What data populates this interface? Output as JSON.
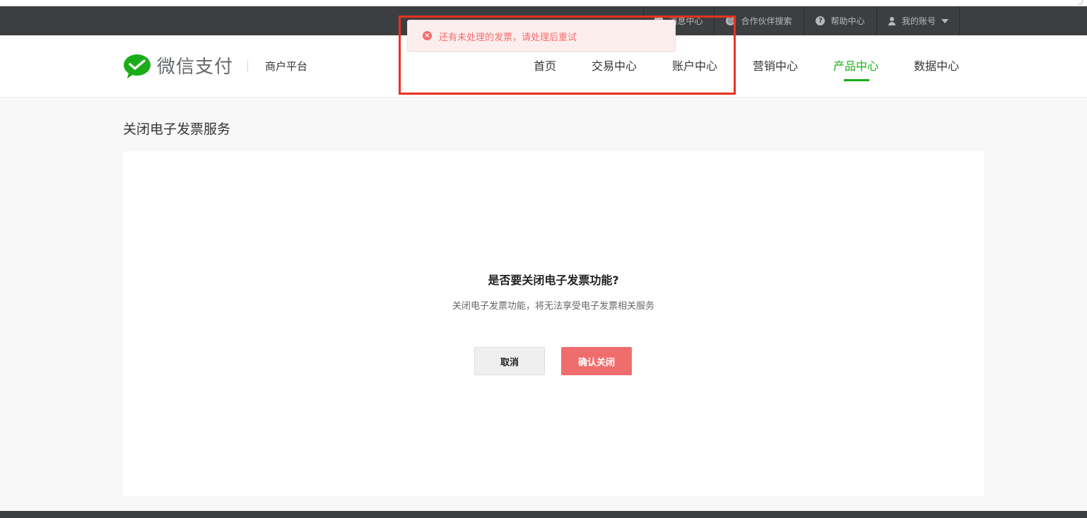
{
  "utilbar": {
    "items": [
      {
        "label": "消息中心",
        "icon": "message-icon"
      },
      {
        "label": "合作伙伴搜索",
        "icon": "partner-search-icon"
      },
      {
        "label": "帮助中心",
        "icon": "help-icon"
      },
      {
        "label": "我的账号",
        "icon": "user-icon"
      }
    ],
    "bg_color": "#3d3e41"
  },
  "header": {
    "brand": "微信支付",
    "subtitle": "商户平台",
    "nav": [
      "首页",
      "交易中心",
      "账户中心",
      "营销中心",
      "产品中心",
      "数据中心"
    ],
    "active_nav": "产品中心",
    "accent_color": "#1aad19"
  },
  "page": {
    "title": "关闭电子发票服务"
  },
  "dialog": {
    "title": "是否要关闭电子发票功能?",
    "description": "关闭电子发票功能，将无法享受电子发票相关服务",
    "cancel_label": "取消",
    "confirm_label": "确认关闭",
    "confirm_color": "#f06d6d"
  },
  "toast": {
    "message": "还有未处理的发票，请处理后重试",
    "type": "error",
    "color": "#f56c6c"
  },
  "annotation": {
    "color": "#e8321f"
  }
}
